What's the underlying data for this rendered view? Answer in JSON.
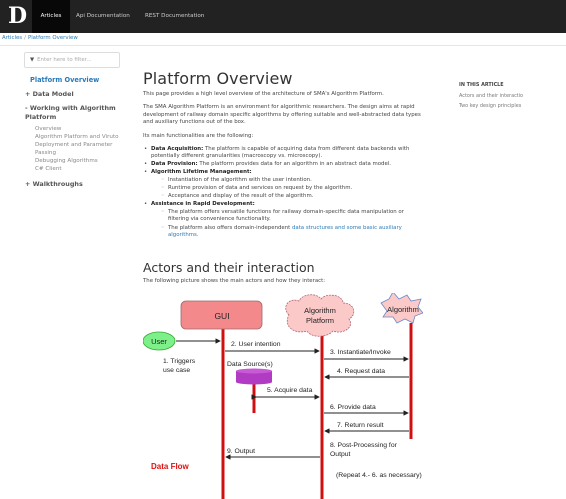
{
  "topbar": {
    "logo": "D",
    "nav": [
      "Articles",
      "Api Documentation",
      "REST Documentation"
    ]
  },
  "breadcrumb": [
    "Articles",
    "Platform Overview"
  ],
  "sidebar": {
    "filter_placeholder": "Enter here to filter...",
    "active": "Platform Overview",
    "data_model": "+ Data Model",
    "working": "- Working with Algorithm Platform",
    "sub": [
      "Overview",
      "Algorithm Platform and Viruto",
      "Deployment and Parameter",
      "Passing",
      "Debugging Algorithms",
      "C# Client"
    ],
    "walkthroughs": "+ Walkthroughs"
  },
  "toc": {
    "heading": "IN THIS ARTICLE",
    "items": [
      "Actors and their interactio",
      "Two key design principles"
    ]
  },
  "article": {
    "title": "Platform Overview",
    "intro": "This page provides a high level overview of the architecture of SMA's Algorithm Platform.",
    "p2": "The SMA Algorithm Platform is an environment for algorithmic researchers. The design aims at rapid development of railway domain specific algorithms by offering suitable and well-abstracted data types and auxiliary functions out of the box.",
    "p3": "Its main functionalities are the following:",
    "f1_label": "Data Acquisition:",
    "f1_text": " The platform is capable of acquiring data from different data backends with potentially different granularities (macroscopy vs. microscopy).",
    "f2_label": "Data Provision:",
    "f2_text": " The platform provides data for an algorithm in an abstract data model.",
    "f3_label": "Algorithm Lifetime Management:",
    "f3_sub": [
      "Instantiation of the algorithm with the user intention.",
      "Runtime provision of data and services on request by the algorithm.",
      "Acceptance and display of the result of the algorithm."
    ],
    "f4_label": "Assistance in Rapid Development:",
    "f4_sub1": "The platform offers versatile functions for railway domain-specific data manipulation or filtering via convenience functionality.",
    "f4_sub2_a": "The platform also offers domain-independent ",
    "f4_sub2_link": "data structures and some basic auxiliary algorithms.",
    "h2": "Actors and their interaction",
    "p4": "The following picture shows the main actors and how they interact:"
  },
  "diagram": {
    "gui": "GUI",
    "platform_line1": "Algorithm",
    "platform_line2": "Platform",
    "algorithm": "Algorithm",
    "user": "User",
    "datasource": "Data Source(s)",
    "triggers_1": "1. Triggers",
    "triggers_2": "use case",
    "m2": "2. User intention",
    "m3": "3. Instantiate/Invoke",
    "m4": "4. Request data",
    "m5": "5. Acquire data",
    "m6": "6. Provide data",
    "m7": "7. Return result",
    "m8_1": "8. Post-Processing for",
    "m8_2": "Output",
    "m9": "9. Output",
    "repeat": "(Repeat 4.- 6. as necessary)",
    "dataflow": "Data Flow",
    "colors": {
      "gui_fill": "#f4898c",
      "platform_fill": "#fbc9c8",
      "algorithm_fill": "#fbc9c8",
      "user_fill": "#7ef08a",
      "db_fill": "#b23bc4",
      "lifeline": "#d01010",
      "dataflow": "#e01010"
    }
  }
}
